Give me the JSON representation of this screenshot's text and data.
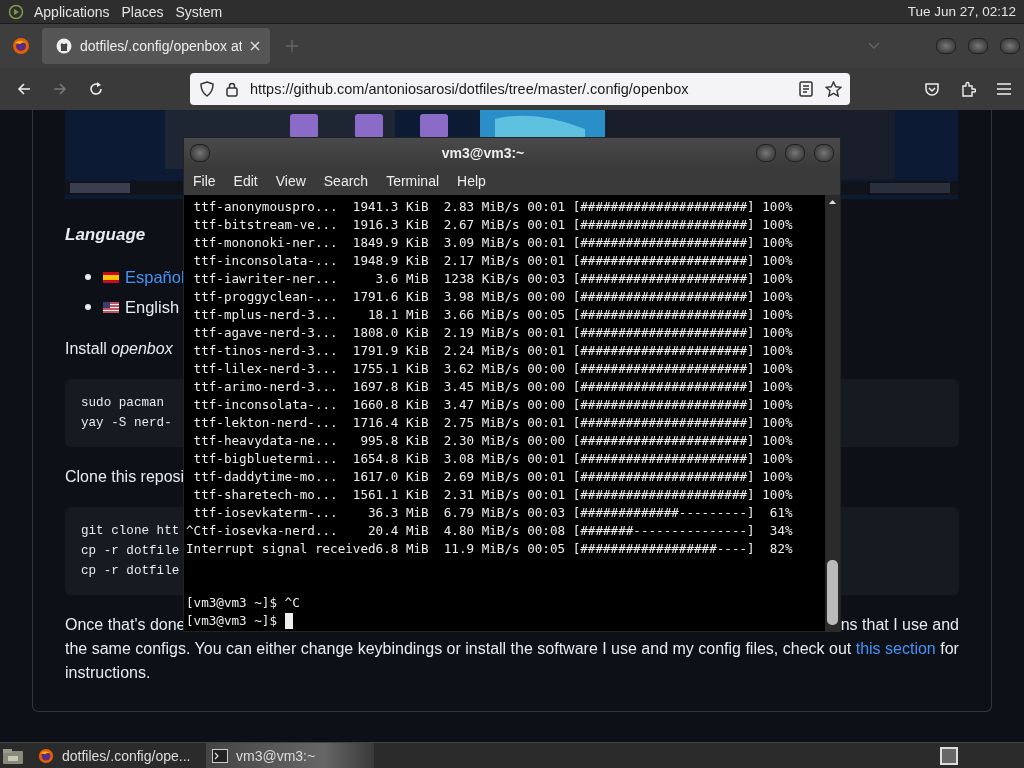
{
  "top_panel": {
    "menus": [
      "Applications",
      "Places",
      "System"
    ],
    "clock": "Tue Jun 27, 02:12"
  },
  "browser": {
    "tabs": [
      {
        "title": "dotfiles/.config/openbox at",
        "selected": true
      }
    ],
    "url": "https://github.com/antoniosarosi/dotfiles/tree/master/.config/openbox",
    "forward_disabled": true
  },
  "page": {
    "image": {
      "kind": "picture"
    },
    "heading": "Language",
    "languages": [
      {
        "label": "Español",
        "link": true
      },
      {
        "label": "English",
        "link": false
      }
    ],
    "install_text": "Install *openbox*",
    "code_block_1": [
      "sudo pacman",
      "yay -S nerd-"
    ],
    "clone_text": "Clone this reposi",
    "code_block_2": [
      "git clone htt",
      "cp -r dotfile",
      "cp -r dotfile"
    ],
    "paragraph_start": "Once that's done",
    "paragraph_end": "ns that I use and",
    "paragraph_rest": {
      "before": "the same configs. You can either change keybindings or install the software I use and my config files, check out",
      "link": "this section",
      "after": "for instructions."
    }
  },
  "terminal": {
    "title": "vm3@vm3:~",
    "menus": [
      "File",
      "Edit",
      "View",
      "Search",
      "Terminal",
      "Help"
    ],
    "lines": [
      " ttf-anonymouspro...  1941.3 KiB  2.83 MiB/s 00:01 [######################] 100%",
      " ttf-bitstream-ve...  1916.3 KiB  2.67 MiB/s 00:01 [######################] 100%",
      " ttf-mononoki-ner...  1849.9 KiB  3.09 MiB/s 00:01 [######################] 100%",
      " ttf-inconsolata-...  1948.9 KiB  2.17 MiB/s 00:01 [######################] 100%",
      " ttf-iawriter-ner...     3.6 MiB  1238 KiB/s 00:03 [######################] 100%",
      " ttf-proggyclean-...  1791.6 KiB  3.98 MiB/s 00:00 [######################] 100%",
      " ttf-mplus-nerd-3...    18.1 MiB  3.66 MiB/s 00:05 [######################] 100%",
      " ttf-agave-nerd-3...  1808.0 KiB  2.19 MiB/s 00:01 [######################] 100%",
      " ttf-tinos-nerd-3...  1791.9 KiB  2.24 MiB/s 00:01 [######################] 100%",
      " ttf-lilex-nerd-3...  1755.1 KiB  3.62 MiB/s 00:00 [######################] 100%",
      " ttf-arimo-nerd-3...  1697.8 KiB  3.45 MiB/s 00:00 [######################] 100%",
      " ttf-inconsolata-...  1660.8 KiB  3.47 MiB/s 00:00 [######################] 100%",
      " ttf-lekton-nerd-...  1716.4 KiB  2.75 MiB/s 00:01 [######################] 100%",
      " ttf-heavydata-ne...   995.8 KiB  2.30 MiB/s 00:00 [######################] 100%",
      " ttf-bigbluetermi...  1654.8 KiB  3.08 MiB/s 00:01 [######################] 100%",
      " ttf-daddytime-mo...  1617.0 KiB  2.69 MiB/s 00:01 [######################] 100%",
      " ttf-sharetech-mo...  1561.1 KiB  2.31 MiB/s 00:01 [######################] 100%",
      " ttf-iosevkaterm-...    36.3 MiB  6.79 MiB/s 00:03 [#############---------]  61%",
      "^Ctf-iosevka-nerd...    20.4 MiB  4.80 MiB/s 00:08 [#######---------------]  34%",
      "Interrupt signal received6.8 MiB  11.9 MiB/s 00:05 [##################----]  82%"
    ],
    "prompt_lines": [
      {
        "text": "[vm3@vm3 ~]$ ^C",
        "cursor": false
      },
      {
        "text": "[vm3@vm3 ~]$",
        "cursor": true
      }
    ]
  },
  "taskbar": {
    "items": [
      {
        "label": "dotfiles/.config/ope...",
        "kind": "browser",
        "selected": false
      },
      {
        "label": "vm3@vm3:~",
        "kind": "terminal",
        "selected": true
      }
    ]
  }
}
